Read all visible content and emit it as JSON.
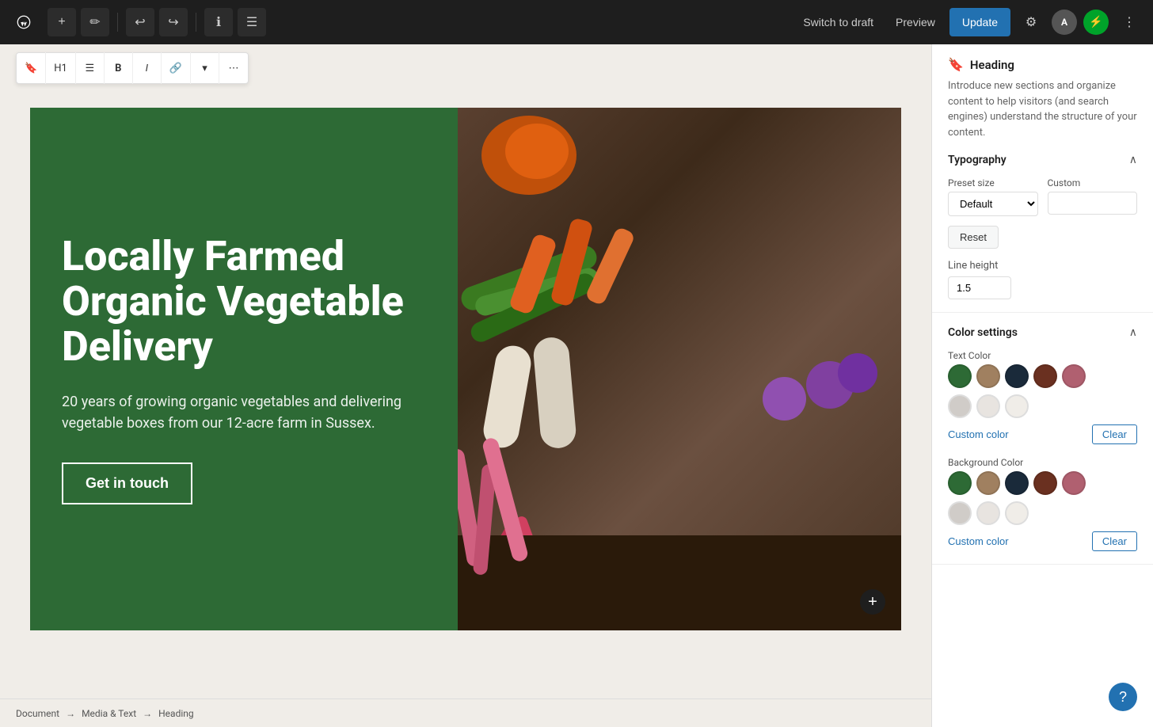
{
  "toolbar": {
    "add_label": "+",
    "edit_label": "✏",
    "undo_label": "↩",
    "redo_label": "↪",
    "info_label": "ℹ",
    "list_label": "☰",
    "switch_draft_label": "Switch to draft",
    "preview_label": "Preview",
    "update_label": "Update",
    "settings_label": "⚙",
    "avatar_label": "A",
    "lightning_label": "⚡",
    "more_label": "⋮"
  },
  "block_toolbar": {
    "bookmark_label": "🔖",
    "h1_label": "H1",
    "align_label": "≡",
    "bold_label": "B",
    "italic_label": "I",
    "link_label": "🔗",
    "dropdown_label": "▾",
    "more_label": "⋯"
  },
  "hero": {
    "heading": "Locally Farmed Organic Vegetable Delivery",
    "subtitle": "20 years of growing organic vegetables and delivering vegetable boxes from our 12-acre farm in Sussex.",
    "button_label": "Get in touch"
  },
  "breadcrumb": {
    "items": [
      "Document",
      "Media & Text",
      "Heading"
    ]
  },
  "right_panel": {
    "heading_info": {
      "icon": "🔖",
      "title": "Heading",
      "description": "Introduce new sections and organize content to help visitors (and search engines) understand the structure of your content."
    },
    "typography": {
      "section_title": "Typography",
      "preset_size_label": "Preset size",
      "custom_label": "Custom",
      "preset_default": "Default",
      "reset_label": "Reset",
      "line_height_label": "Line height",
      "line_height_value": "1.5"
    },
    "color_settings": {
      "section_title": "Color settings",
      "text_color_label": "Text Color",
      "text_colors": [
        {
          "id": "green",
          "hex": "#2d6a35",
          "light": false
        },
        {
          "id": "tan",
          "hex": "#a08060",
          "light": false
        },
        {
          "id": "navy",
          "hex": "#1a2a3a",
          "light": false
        },
        {
          "id": "brown",
          "hex": "#6a3020",
          "light": false
        },
        {
          "id": "mauve",
          "hex": "#b06070",
          "light": false
        },
        {
          "id": "light-gray",
          "hex": "#d0ccc8",
          "light": true
        },
        {
          "id": "off-white",
          "hex": "#e8e4e0",
          "light": true
        },
        {
          "id": "white",
          "hex": "#f0ede8",
          "light": true
        }
      ],
      "custom_color_label": "Custom color",
      "clear_label": "Clear",
      "background_color_label": "Background Color",
      "bg_colors": [
        {
          "id": "bg-green",
          "hex": "#2d6a35",
          "light": false
        },
        {
          "id": "bg-tan",
          "hex": "#a08060",
          "light": false
        },
        {
          "id": "bg-navy",
          "hex": "#1a2a3a",
          "light": false
        },
        {
          "id": "bg-brown",
          "hex": "#6a3020",
          "light": false
        },
        {
          "id": "bg-mauve",
          "hex": "#b06070",
          "light": false
        },
        {
          "id": "bg-light-gray",
          "hex": "#d0ccc8",
          "light": true
        },
        {
          "id": "bg-off-white",
          "hex": "#e8e4e0",
          "light": true
        },
        {
          "id": "bg-white",
          "hex": "#f0ede8",
          "light": true
        }
      ],
      "bg_custom_color_label": "Custom color",
      "bg_clear_label": "Clear"
    }
  }
}
